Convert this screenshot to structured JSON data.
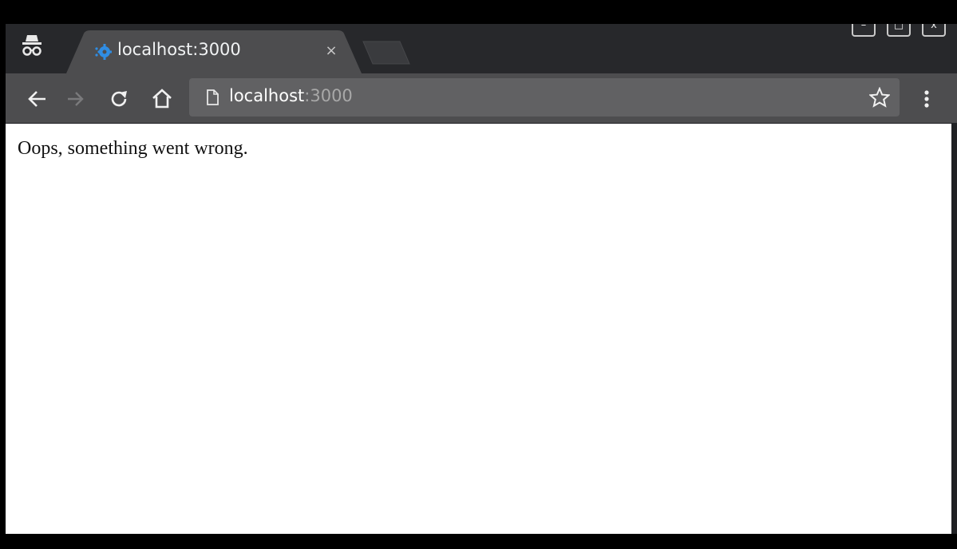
{
  "tab": {
    "title": "localhost:3000",
    "close_glyph": "×",
    "favicon": "blue-gear-icon"
  },
  "window_controls": {
    "minimize": "–",
    "maximize": "□",
    "close": "x"
  },
  "toolbar": {
    "url_host": "localhost",
    "url_port": ":3000"
  },
  "page": {
    "message": "Oops, something went wrong."
  },
  "colors": {
    "tabstrip": "#27282b",
    "toolbar": "#4d4d4f",
    "omnibox": "#616163",
    "favicon": "#2f8de4"
  }
}
